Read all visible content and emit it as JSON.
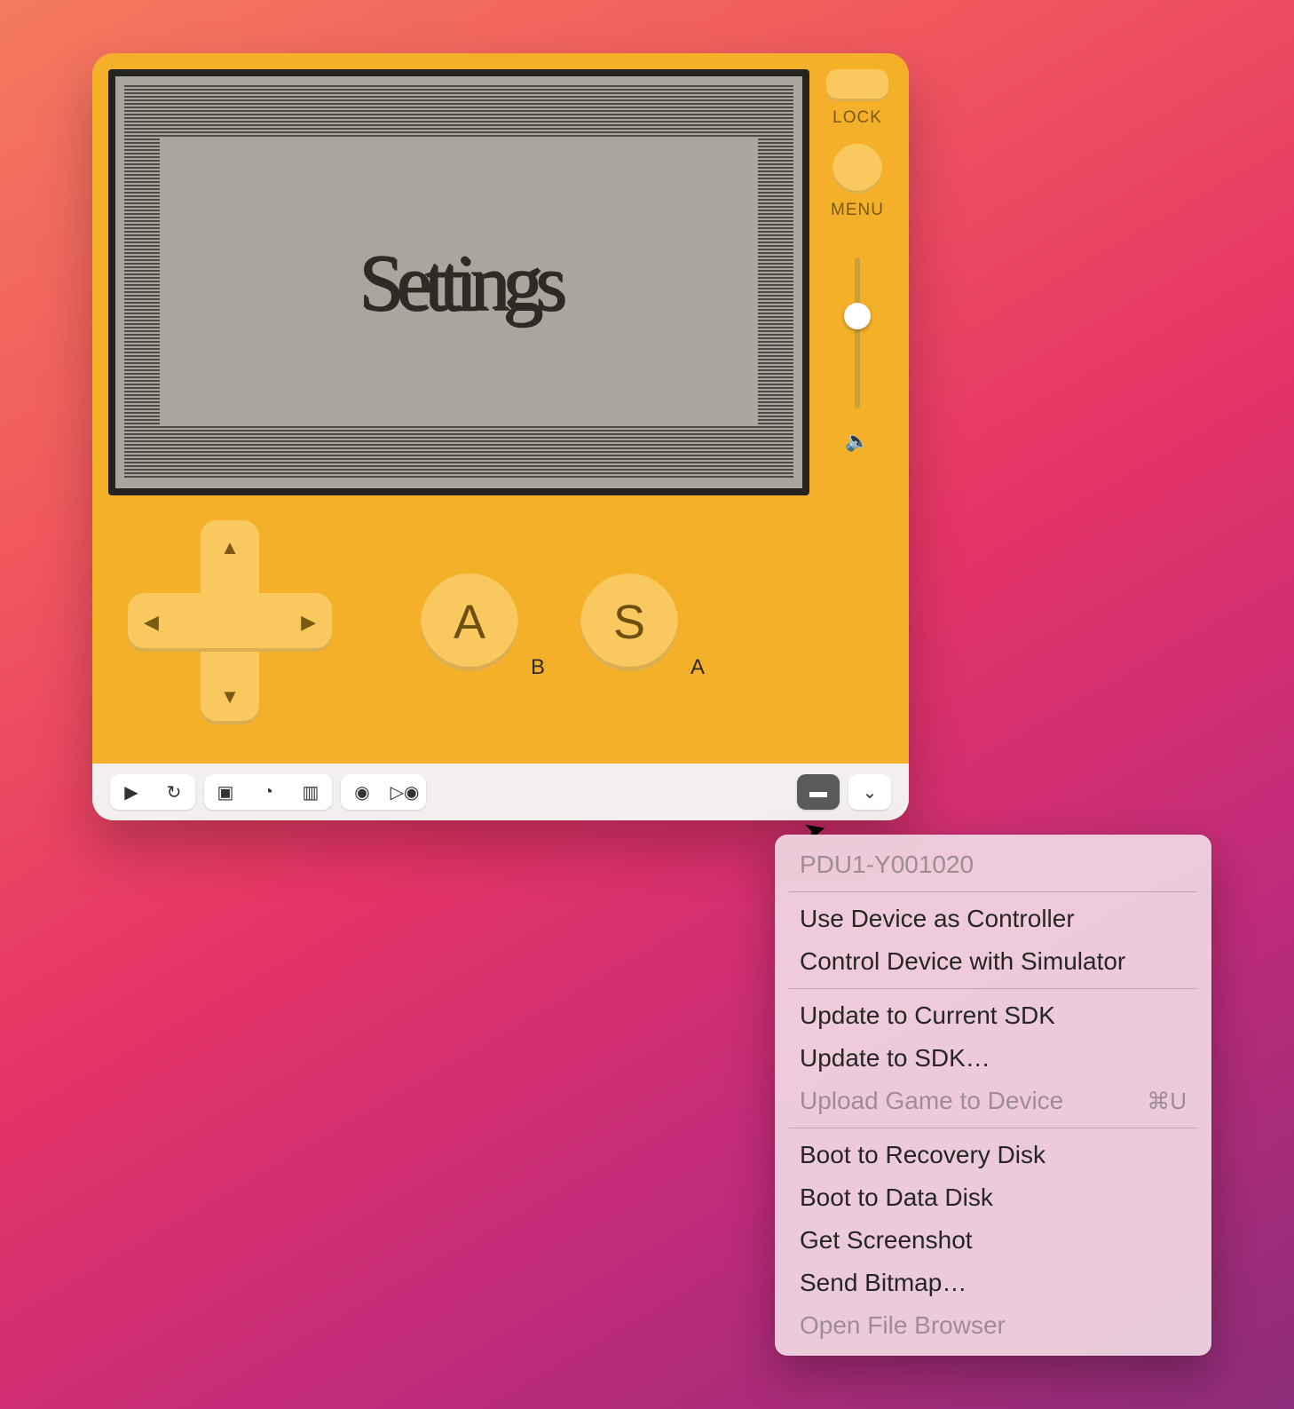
{
  "device": {
    "lock_label": "LOCK",
    "menu_label": "MENU",
    "screen_title": "Settings",
    "dpad": {
      "up": "▲",
      "down": "▼",
      "left": "◀",
      "right": "▶"
    },
    "buttons": {
      "a": {
        "key": "A",
        "hw": "B"
      },
      "b": {
        "key": "S",
        "hw": "A"
      }
    }
  },
  "toolbar": {
    "play": "▶",
    "restart": "↻",
    "console": "▣",
    "timer": "◔",
    "cpu": "▥",
    "camera": "◉",
    "record": "▷◉",
    "device": "▬",
    "chevron": "⌄"
  },
  "menu": {
    "header": "PDU1-Y001020",
    "items": [
      {
        "label": "Use Device as Controller",
        "enabled": true
      },
      {
        "label": "Control Device with Simulator",
        "enabled": true
      },
      {
        "sep": true
      },
      {
        "label": "Update to Current SDK",
        "enabled": true
      },
      {
        "label": "Update to SDK…",
        "enabled": true
      },
      {
        "label": "Upload Game to Device",
        "enabled": false,
        "shortcut": "⌘U"
      },
      {
        "sep": true
      },
      {
        "label": "Boot to Recovery Disk",
        "enabled": true
      },
      {
        "label": "Boot to Data Disk",
        "enabled": true
      },
      {
        "label": "Get Screenshot",
        "enabled": true
      },
      {
        "label": "Send Bitmap…",
        "enabled": true
      },
      {
        "label": "Open File Browser",
        "enabled": false
      }
    ]
  }
}
